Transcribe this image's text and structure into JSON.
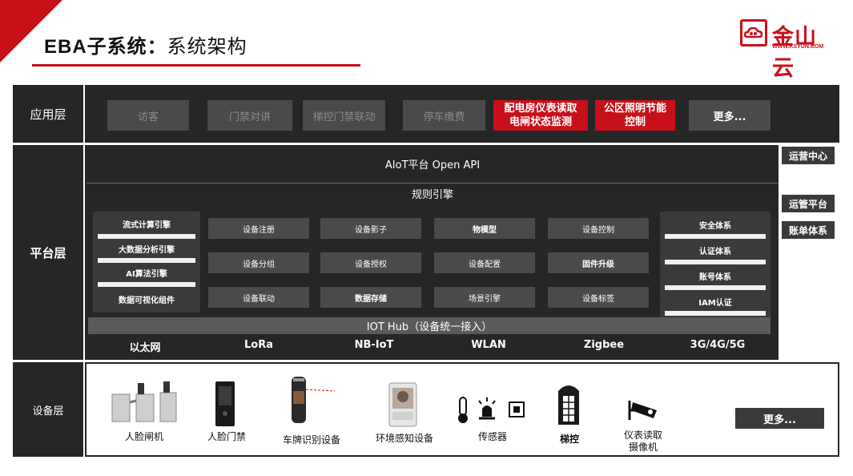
{
  "header": {
    "title_bold": "EBA子系统：",
    "title_rest": "系统架构",
    "logo_text": "金山云",
    "logo_sub": "WWW.KSYUN.COM"
  },
  "layers": {
    "app": "应用层",
    "platform": "平台层",
    "device": "设备层"
  },
  "app_layer": {
    "buttons": [
      "访客",
      "门禁对讲",
      "梯控门禁联动",
      "停车缴费"
    ],
    "red_buttons": [
      [
        "配电房仪表读取",
        "电闸状态监测"
      ],
      [
        "公区照明节能",
        "控制"
      ]
    ],
    "more": "更多..."
  },
  "platform_layer": {
    "api": "AIoT平台 Open API",
    "rule_engine": "规则引擎",
    "left_stack": [
      "流式计算引擎",
      "大数据分析引擎",
      "AI算法引擎",
      "数据可视化组件"
    ],
    "grid": [
      [
        "设备注册",
        "设备影子",
        "物模型",
        "设备控制"
      ],
      [
        "设备分组",
        "设备授权",
        "设备配置",
        "固件升级"
      ],
      [
        "设备联动",
        "数据存储",
        "场景引擎",
        "设备标签"
      ]
    ],
    "right_stack": [
      "安全体系",
      "认证体系",
      "账号体系",
      "IAM认证"
    ],
    "hub": "IOT Hub（设备统一接入）",
    "networks": [
      "以太网",
      "LoRa",
      "NB-IoT",
      "WLAN",
      "Zigbee",
      "3G/4G/5G"
    ]
  },
  "side_panel": [
    "运营中心",
    "运管平台",
    "账单体系"
  ],
  "device_layer": {
    "items": [
      "人脸闸机",
      "人脸门禁",
      "车牌识别设备",
      "环境感知设备",
      "传感器",
      "梯控"
    ],
    "meter_camera": [
      "仪表读取",
      "摄像机"
    ],
    "more": "更多..."
  },
  "colors": {
    "accent": "#c8101a",
    "dark": "#262626",
    "button": "#4a4a4a"
  }
}
